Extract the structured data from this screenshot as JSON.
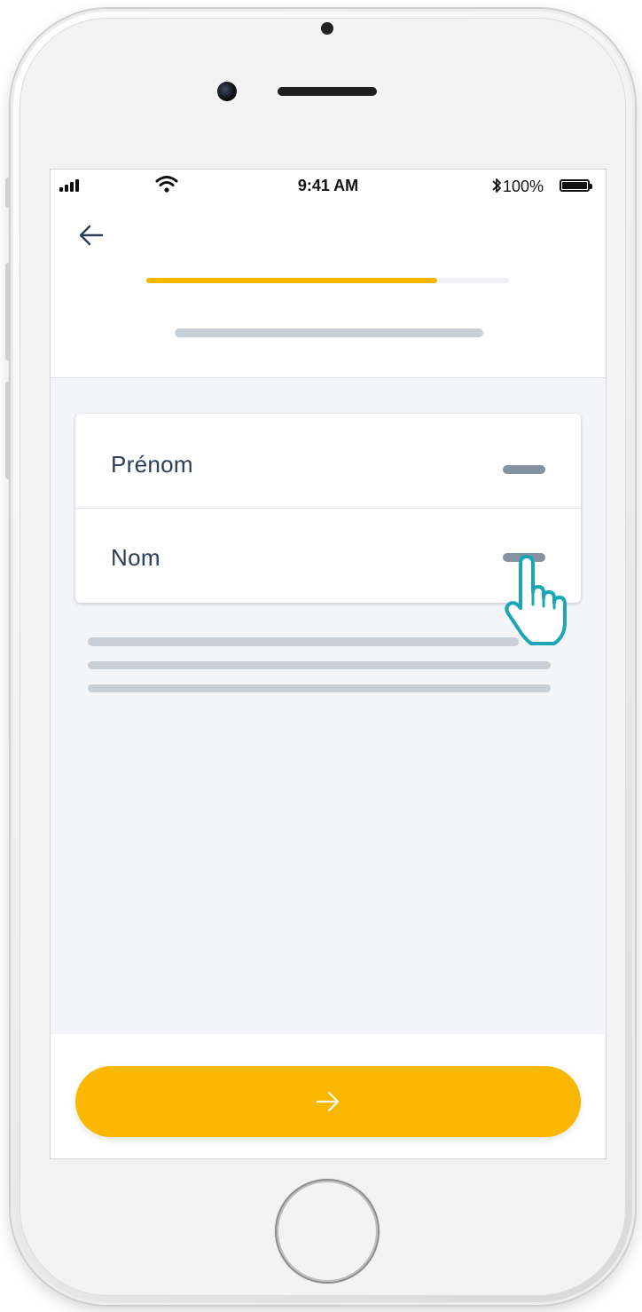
{
  "status_bar": {
    "time": "9:41 AM",
    "battery_percent": "100%",
    "bluetooth_glyph": "✱",
    "icons": [
      "signal-icon",
      "wifi-icon",
      "bluetooth-icon",
      "battery-icon"
    ]
  },
  "navigation": {
    "back_icon": "arrow-left-icon"
  },
  "progress": {
    "value": 0.8,
    "fill_color": "#f9b700",
    "track_color": "#eef0f4"
  },
  "form": {
    "fields": [
      {
        "label": "Prénom"
      },
      {
        "label": "Nom"
      }
    ]
  },
  "next_button": {
    "icon": "arrow-right-icon",
    "color": "#f9b700"
  },
  "pointer": {
    "icon": "hand-pointer-icon",
    "color": "#1aa6b7"
  }
}
